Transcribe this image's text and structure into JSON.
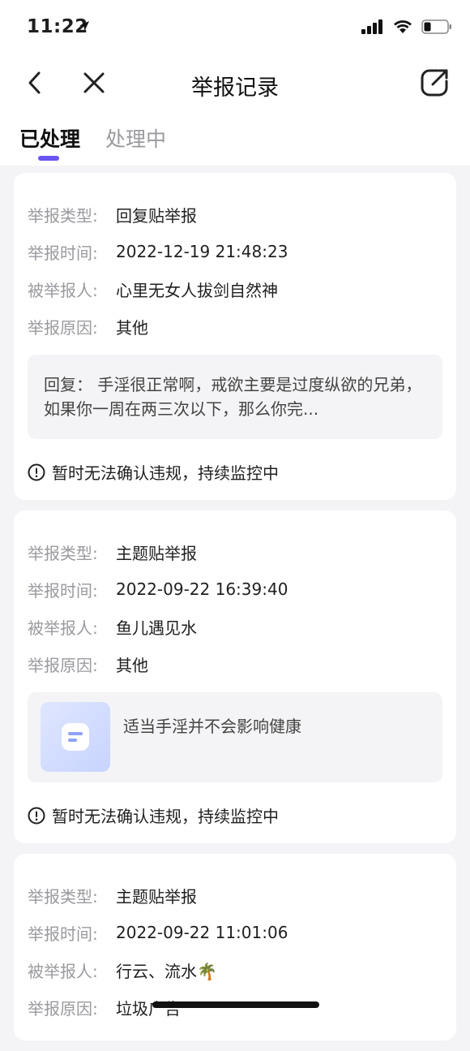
{
  "status_bar": {
    "time": "11:22"
  },
  "nav": {
    "title": "举报记录"
  },
  "tabs": [
    {
      "label": "已处理",
      "active": true
    },
    {
      "label": "处理中",
      "active": false
    }
  ],
  "colors": {
    "accent": "#6a55f0",
    "label_gray": "#9a9a9f",
    "card_bg": "#ffffff",
    "page_bg": "#f4f4f6"
  },
  "labels": {
    "type": "举报类型:",
    "time": "举报时间:",
    "person": "被举报人:",
    "reason": "举报原因:"
  },
  "reports": [
    {
      "type": "回复贴举报",
      "time": "2022-12-19 21:48:23",
      "person": "心里无女人拔剑自然神",
      "reason": "其他",
      "content_kind": "reply",
      "content": "回复： 手淫很正常啊，戒欲主要是过度纵欲的兄弟，如果你一周在两三次以下，那么你完...",
      "result": "暂时无法确认违规，持续监控中"
    },
    {
      "type": "主题贴举报",
      "time": "2022-09-22 16:39:40",
      "person": "鱼儿遇见水",
      "reason": "其他",
      "content_kind": "post",
      "content": "适当手淫并不会影响健康",
      "result": "暂时无法确认违规，持续监控中"
    },
    {
      "type": "主题贴举报",
      "time": "2022-09-22 11:01:06",
      "person": "行云、流水🌴",
      "reason": "垃圾广告"
    }
  ]
}
